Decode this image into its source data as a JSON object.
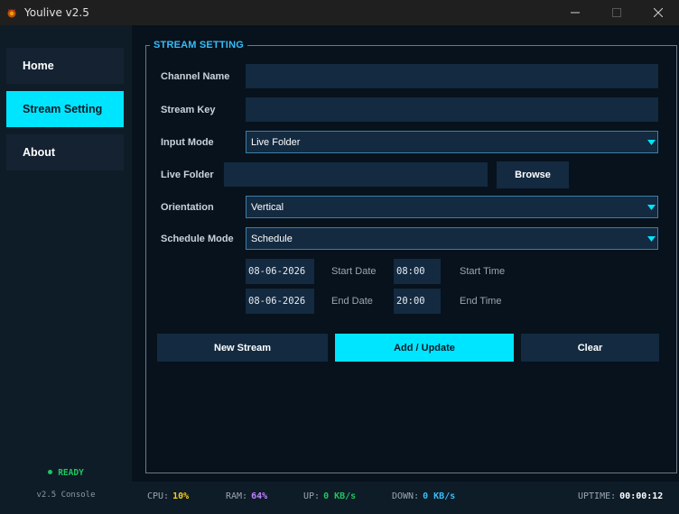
{
  "window": {
    "title": "Youlive v2.5"
  },
  "sidebar": {
    "items": [
      {
        "label": "Home",
        "active": false
      },
      {
        "label": "Stream Setting",
        "active": true
      },
      {
        "label": "About",
        "active": false
      }
    ],
    "status": "READY",
    "console_label": "v2.5 Console"
  },
  "form": {
    "group_title": "STREAM SETTING",
    "channel_name": {
      "label": "Channel Name",
      "value": ""
    },
    "stream_key": {
      "label": "Stream Key",
      "value": ""
    },
    "input_mode": {
      "label": "Input Mode",
      "value": "Live Folder"
    },
    "live_folder": {
      "label": "Live Folder",
      "value": "",
      "browse_label": "Browse"
    },
    "orientation": {
      "label": "Orientation",
      "value": "Vertical"
    },
    "schedule_mode": {
      "label": "Schedule Mode",
      "value": "Schedule"
    },
    "start_date": {
      "value": "08-06-2026",
      "label": "Start Date"
    },
    "start_time": {
      "value": "08:00",
      "label": "Start Time"
    },
    "end_date": {
      "value": "08-06-2026",
      "label": "End Date"
    },
    "end_time": {
      "value": "20:00",
      "label": "End Time"
    },
    "buttons": {
      "new_stream": "New Stream",
      "add_update": "Add / Update",
      "clear": "Clear"
    }
  },
  "statusbar": {
    "cpu": {
      "label": "CPU:",
      "value": "10%",
      "color": "#facc15"
    },
    "ram": {
      "label": "RAM:",
      "value": "64%",
      "color": "#c084fc"
    },
    "up": {
      "label": "UP:",
      "value": "0 KB/s",
      "color": "#22c55e"
    },
    "down": {
      "label": "DOWN:",
      "value": "0 KB/s",
      "color": "#38bdf8"
    },
    "uptime": {
      "label": "UPTIME:",
      "value": "00:00:12",
      "color": "#ffffff"
    }
  },
  "colors": {
    "accent": "#00e5ff",
    "ready": "#22c55e",
    "group_title": "#38bdf8"
  }
}
